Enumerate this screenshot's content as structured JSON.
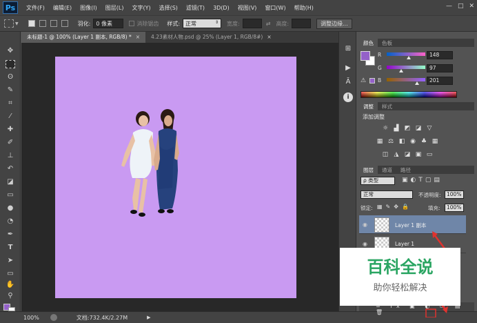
{
  "app": {
    "logo_text": "Ps"
  },
  "menu": [
    "文件(F)",
    "编辑(E)",
    "图像(I)",
    "图层(L)",
    "文字(Y)",
    "选择(S)",
    "滤镜(T)",
    "3D(D)",
    "视图(V)",
    "窗口(W)",
    "帮助(H)"
  ],
  "window_controls": {
    "minimize": "—",
    "maximize": "□",
    "close": "✕"
  },
  "options": {
    "feather_label": "羽化:",
    "feather_value": "0 像素",
    "antialias_label": "消除锯齿",
    "style_label": "样式:",
    "style_value": "正常",
    "width_label": "宽度:",
    "height_label": "高度:",
    "refine_edge": "调整边缘..."
  },
  "doc_tabs": [
    {
      "label": "未标题-1 @ 100% (Layer 1 副本, RGB/8) *",
      "close": "×"
    },
    {
      "label": "4.23素材人物.psd @ 25% (Layer 1, RGB/8#)",
      "close": "×"
    }
  ],
  "status": {
    "zoom": "100%",
    "doc_info": "文档:732.4K/2.27M",
    "arrow": "▶"
  },
  "color_panel": {
    "tabs": [
      "颜色",
      "色板"
    ],
    "r_label": "R",
    "g_label": "G",
    "b_label": "B",
    "r": "148",
    "g": "97",
    "b": "201",
    "r_pos": 0.58,
    "g_pos": 0.38,
    "b_pos": 0.79,
    "fg_color": "#9461c9",
    "bg_color": "#ffffff"
  },
  "adjust_panel": {
    "tabs": [
      "调整",
      "样式"
    ],
    "title": "添加调整"
  },
  "layers_panel": {
    "tabs": [
      "图层",
      "通道",
      "路径"
    ],
    "filter_label": "ρ 类型",
    "blend_mode": "正常",
    "opacity_label": "不透明度:",
    "opacity_value": "100%",
    "lock_label": "锁定:",
    "fill_label": "填充:",
    "fill_value": "100%",
    "layers": [
      {
        "name": "Layer 1 副本",
        "visible": true,
        "selected": true
      },
      {
        "name": "Layer 1",
        "visible": true,
        "selected": false
      }
    ]
  },
  "watermark": {
    "title": "百科全说",
    "subtitle": "助你轻松解决"
  },
  "colors": {
    "canvas": "#c99af2",
    "accent": "#30a6f5",
    "arrow": "#e0322e",
    "watermark_green": "#2aa562"
  }
}
